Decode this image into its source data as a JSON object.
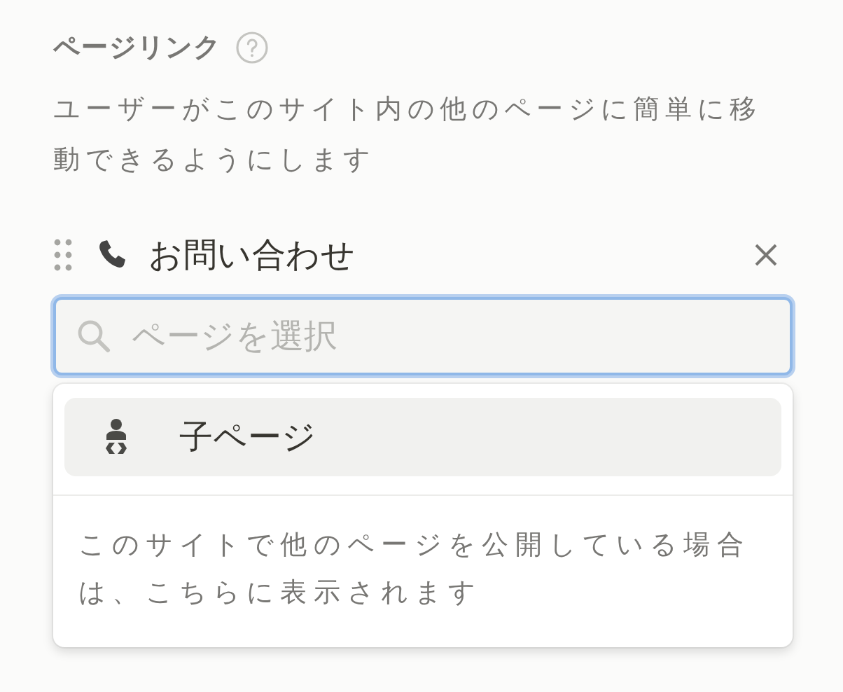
{
  "section": {
    "title": "ページリンク",
    "description": "ユーザーがこのサイト内の他のページに簡単に移動できるようにします"
  },
  "links": [
    {
      "label": "お問い合わせ"
    }
  ],
  "search": {
    "placeholder": "ページを選択",
    "focused": true
  },
  "dropdown": {
    "items": [
      {
        "label": "子ページ",
        "selected": true
      }
    ],
    "note": "このサイトで他のページを公開している場合は、こちらに表示されます"
  }
}
